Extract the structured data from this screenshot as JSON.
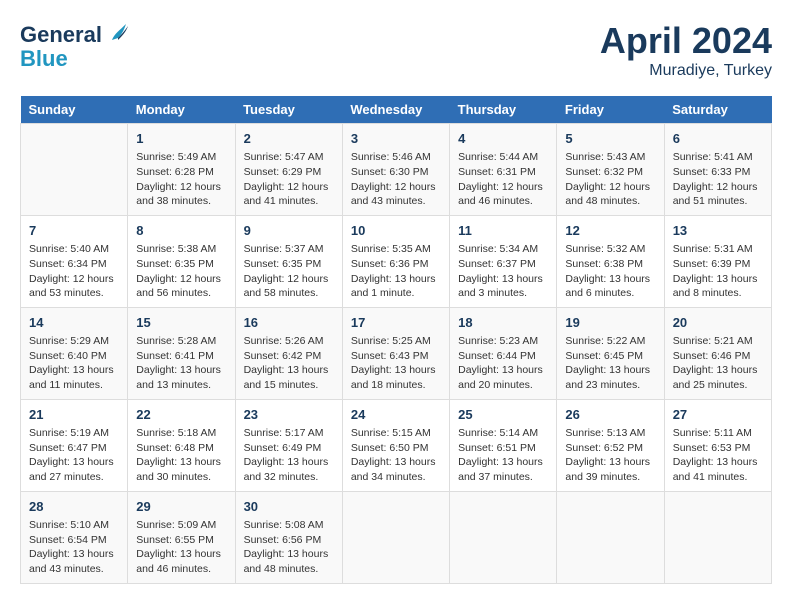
{
  "header": {
    "logo_line1": "General",
    "logo_line2": "Blue",
    "month": "April 2024",
    "location": "Muradiye, Turkey"
  },
  "days_of_week": [
    "Sunday",
    "Monday",
    "Tuesday",
    "Wednesday",
    "Thursday",
    "Friday",
    "Saturday"
  ],
  "weeks": [
    [
      {
        "day": "",
        "info": ""
      },
      {
        "day": "1",
        "info": "Sunrise: 5:49 AM\nSunset: 6:28 PM\nDaylight: 12 hours\nand 38 minutes."
      },
      {
        "day": "2",
        "info": "Sunrise: 5:47 AM\nSunset: 6:29 PM\nDaylight: 12 hours\nand 41 minutes."
      },
      {
        "day": "3",
        "info": "Sunrise: 5:46 AM\nSunset: 6:30 PM\nDaylight: 12 hours\nand 43 minutes."
      },
      {
        "day": "4",
        "info": "Sunrise: 5:44 AM\nSunset: 6:31 PM\nDaylight: 12 hours\nand 46 minutes."
      },
      {
        "day": "5",
        "info": "Sunrise: 5:43 AM\nSunset: 6:32 PM\nDaylight: 12 hours\nand 48 minutes."
      },
      {
        "day": "6",
        "info": "Sunrise: 5:41 AM\nSunset: 6:33 PM\nDaylight: 12 hours\nand 51 minutes."
      }
    ],
    [
      {
        "day": "7",
        "info": "Sunrise: 5:40 AM\nSunset: 6:34 PM\nDaylight: 12 hours\nand 53 minutes."
      },
      {
        "day": "8",
        "info": "Sunrise: 5:38 AM\nSunset: 6:35 PM\nDaylight: 12 hours\nand 56 minutes."
      },
      {
        "day": "9",
        "info": "Sunrise: 5:37 AM\nSunset: 6:35 PM\nDaylight: 12 hours\nand 58 minutes."
      },
      {
        "day": "10",
        "info": "Sunrise: 5:35 AM\nSunset: 6:36 PM\nDaylight: 13 hours\nand 1 minute."
      },
      {
        "day": "11",
        "info": "Sunrise: 5:34 AM\nSunset: 6:37 PM\nDaylight: 13 hours\nand 3 minutes."
      },
      {
        "day": "12",
        "info": "Sunrise: 5:32 AM\nSunset: 6:38 PM\nDaylight: 13 hours\nand 6 minutes."
      },
      {
        "day": "13",
        "info": "Sunrise: 5:31 AM\nSunset: 6:39 PM\nDaylight: 13 hours\nand 8 minutes."
      }
    ],
    [
      {
        "day": "14",
        "info": "Sunrise: 5:29 AM\nSunset: 6:40 PM\nDaylight: 13 hours\nand 11 minutes."
      },
      {
        "day": "15",
        "info": "Sunrise: 5:28 AM\nSunset: 6:41 PM\nDaylight: 13 hours\nand 13 minutes."
      },
      {
        "day": "16",
        "info": "Sunrise: 5:26 AM\nSunset: 6:42 PM\nDaylight: 13 hours\nand 15 minutes."
      },
      {
        "day": "17",
        "info": "Sunrise: 5:25 AM\nSunset: 6:43 PM\nDaylight: 13 hours\nand 18 minutes."
      },
      {
        "day": "18",
        "info": "Sunrise: 5:23 AM\nSunset: 6:44 PM\nDaylight: 13 hours\nand 20 minutes."
      },
      {
        "day": "19",
        "info": "Sunrise: 5:22 AM\nSunset: 6:45 PM\nDaylight: 13 hours\nand 23 minutes."
      },
      {
        "day": "20",
        "info": "Sunrise: 5:21 AM\nSunset: 6:46 PM\nDaylight: 13 hours\nand 25 minutes."
      }
    ],
    [
      {
        "day": "21",
        "info": "Sunrise: 5:19 AM\nSunset: 6:47 PM\nDaylight: 13 hours\nand 27 minutes."
      },
      {
        "day": "22",
        "info": "Sunrise: 5:18 AM\nSunset: 6:48 PM\nDaylight: 13 hours\nand 30 minutes."
      },
      {
        "day": "23",
        "info": "Sunrise: 5:17 AM\nSunset: 6:49 PM\nDaylight: 13 hours\nand 32 minutes."
      },
      {
        "day": "24",
        "info": "Sunrise: 5:15 AM\nSunset: 6:50 PM\nDaylight: 13 hours\nand 34 minutes."
      },
      {
        "day": "25",
        "info": "Sunrise: 5:14 AM\nSunset: 6:51 PM\nDaylight: 13 hours\nand 37 minutes."
      },
      {
        "day": "26",
        "info": "Sunrise: 5:13 AM\nSunset: 6:52 PM\nDaylight: 13 hours\nand 39 minutes."
      },
      {
        "day": "27",
        "info": "Sunrise: 5:11 AM\nSunset: 6:53 PM\nDaylight: 13 hours\nand 41 minutes."
      }
    ],
    [
      {
        "day": "28",
        "info": "Sunrise: 5:10 AM\nSunset: 6:54 PM\nDaylight: 13 hours\nand 43 minutes."
      },
      {
        "day": "29",
        "info": "Sunrise: 5:09 AM\nSunset: 6:55 PM\nDaylight: 13 hours\nand 46 minutes."
      },
      {
        "day": "30",
        "info": "Sunrise: 5:08 AM\nSunset: 6:56 PM\nDaylight: 13 hours\nand 48 minutes."
      },
      {
        "day": "",
        "info": ""
      },
      {
        "day": "",
        "info": ""
      },
      {
        "day": "",
        "info": ""
      },
      {
        "day": "",
        "info": ""
      }
    ]
  ]
}
